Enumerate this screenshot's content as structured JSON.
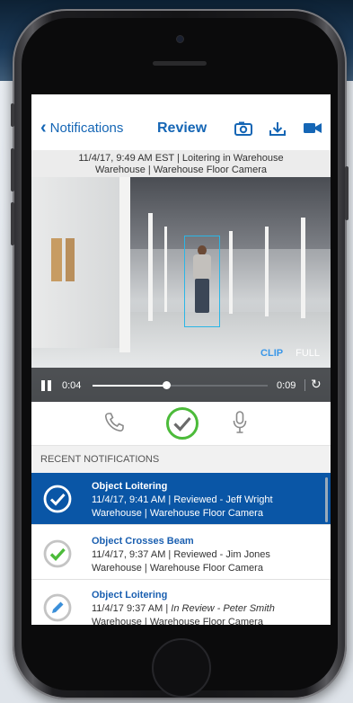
{
  "nav": {
    "back_label": "Notifications",
    "title": "Review",
    "icons": [
      "camera-snapshot-icon",
      "download-icon",
      "video-camera-icon"
    ]
  },
  "event_info": {
    "line1": "11/4/17, 9:49 AM EST | Loitering in Warehouse",
    "line2": "Warehouse | Warehouse Floor Camera"
  },
  "player": {
    "clip_label": "CLIP",
    "full_label": "FULL",
    "current_time": "0:04",
    "total_time": "0:09",
    "progress": 0.42
  },
  "actions": [
    "phone-icon",
    "check-icon",
    "microphone-icon"
  ],
  "notifications_header": "RECENT NOTIFICATIONS",
  "notifications": [
    {
      "title": "Object Loitering",
      "line2": "11/4/17, 9:41 AM | Reviewed - Jeff Wright",
      "line3": "Warehouse | Warehouse Floor Camera",
      "status": "selected"
    },
    {
      "title": "Object Crosses Beam",
      "line2": "11/4/17, 9:37 AM | Reviewed - Jim Jones",
      "line3": "Warehouse | Warehouse Floor Camera",
      "status": "reviewed"
    },
    {
      "title": "Object Loitering",
      "line2_prefix": "11/4/17 9:37 AM | ",
      "line2_italic": "In Review - Peter Smith",
      "line3": "Warehouse | Warehouse Floor Camera",
      "status": "in-review"
    }
  ],
  "colors": {
    "accent": "#1566b5",
    "selected_row": "#0a56a6",
    "check_green": "#4cbb3a",
    "clip_blue": "#3a97e8",
    "bbox_cyan": "#2bb6e6"
  }
}
